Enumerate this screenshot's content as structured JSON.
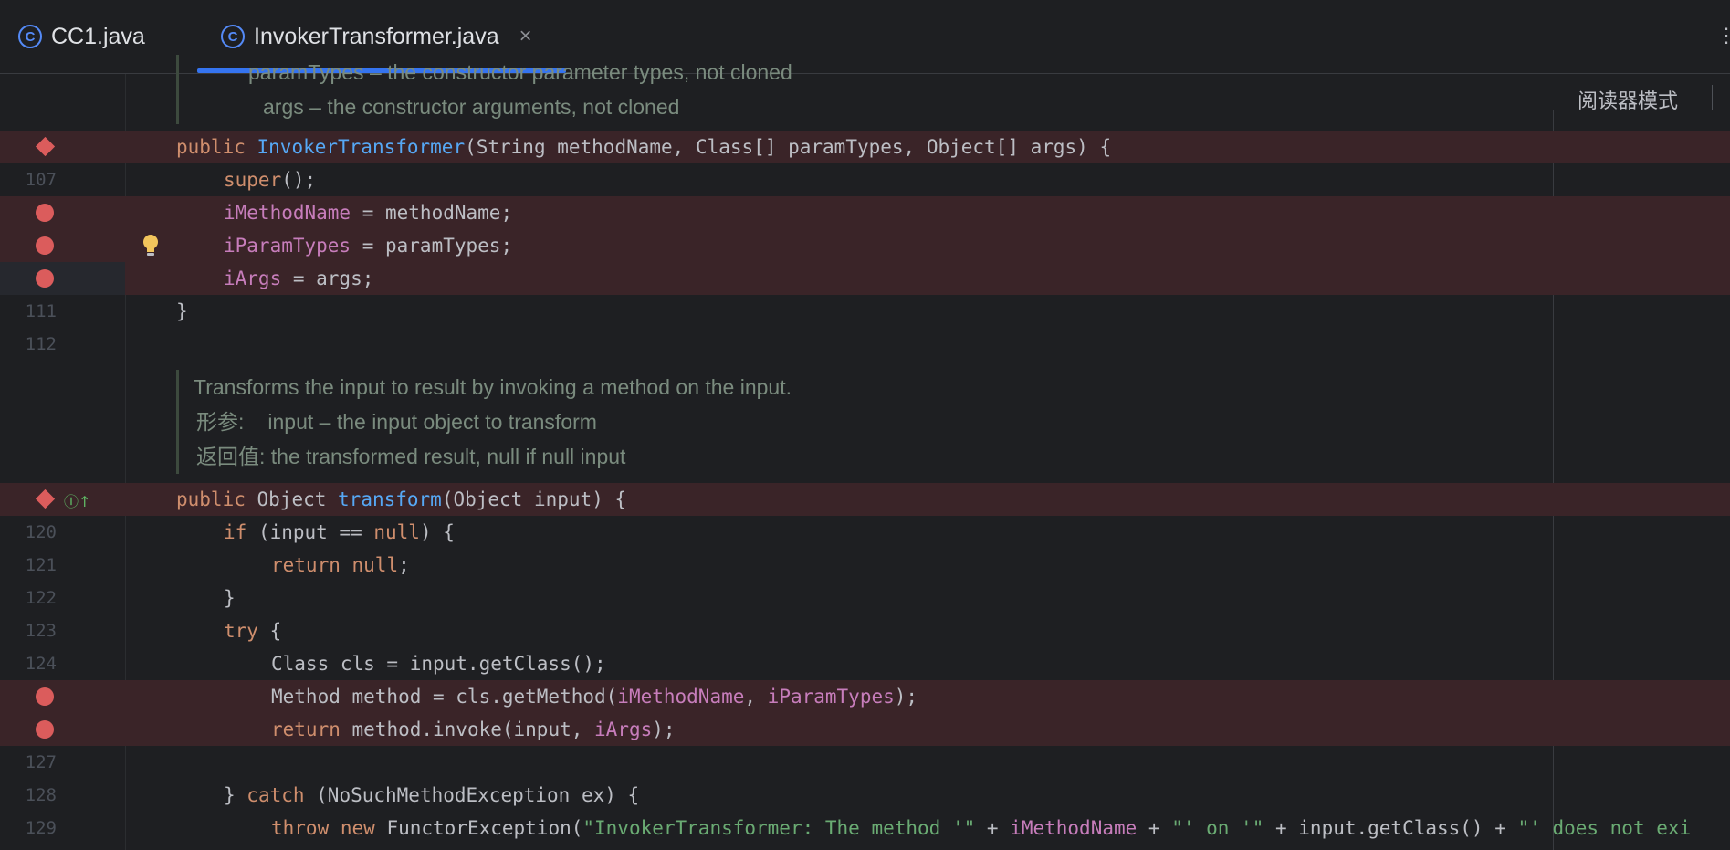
{
  "tabs": [
    {
      "icon": "class-icon",
      "icon_letter": "C",
      "label": "CC1.java",
      "active": false
    },
    {
      "icon": "class-icon",
      "icon_letter": "C",
      "label": "InvokerTransformer.java",
      "active": true,
      "close": "×"
    }
  ],
  "editor": {
    "reader_mode_label": "阅读器模式",
    "doc_top": {
      "partial_line": "paramTypes – the constructor parameter types, not cloned",
      "args_line": "args – the constructor arguments, not cloned"
    },
    "doc_transform": {
      "summary": "Transforms the input to result by invoking a method on the input.",
      "param_tag": "形参:",
      "param_text": "input – the input object to transform",
      "return_tag": "返回值:",
      "return_text": "the transformed result, null if null input"
    },
    "line_numbers": {
      "l107": "107",
      "l111": "111",
      "l112": "112",
      "l120": "120",
      "l121": "121",
      "l122": "122",
      "l123": "123",
      "l124": "124",
      "l127": "127",
      "l128": "128",
      "l129": "129"
    },
    "code": {
      "constructor_sig": {
        "kw": "public ",
        "name": "InvokerTransformer",
        "rest": "(String methodName, Class[] paramTypes, Object[] args) {"
      },
      "super_call": {
        "kw": "super",
        "rest": "();"
      },
      "assign1": {
        "field": "iMethodName",
        "rest": " = methodName;"
      },
      "assign2": {
        "field": "iParamTypes",
        "rest": " = paramTypes;"
      },
      "assign3": {
        "field": "iArgs",
        "rest": " = args;"
      },
      "close_brace": "}",
      "transform_sig": {
        "kw": "public ",
        "type": "Object ",
        "name": "transform",
        "rest": "(Object input) {"
      },
      "if_line": {
        "kw": "if ",
        "mid": "(input == ",
        "null": "null",
        "rest": ") {"
      },
      "return_null": {
        "kw": "return ",
        "null": "null",
        "rest": ";"
      },
      "if_close": "}",
      "try_line": {
        "kw": "try ",
        "rest": "{"
      },
      "class_line": "Class cls = input.getClass();",
      "method_line": {
        "pre": "Method method = cls.getMethod(",
        "f1": "iMethodName",
        "mid": ", ",
        "f2": "iParamTypes",
        "rest": ");"
      },
      "return_invoke": {
        "kw": "return ",
        "pre": "method.invoke(input, ",
        "field": "iArgs",
        "rest": ");"
      },
      "catch_line": {
        "pre": "} ",
        "kw": "catch ",
        "rest": "(NoSuchMethodException ex) {"
      },
      "throw_line": {
        "kw1": "throw ",
        "kw2": "new ",
        "pre": "FunctorException(",
        "s1": "\"InvokerTransformer: The method '\"",
        "p1": " + ",
        "field": "iMethodName",
        "p2": " + ",
        "s2": "\"' on '\"",
        "p3": " + input.getClass() + ",
        "s3": "\"' does not exi"
      }
    }
  },
  "colors": {
    "background": "#1e1f22",
    "breakpoint_line": "#3a2428",
    "breakpoint": "#db5c5c",
    "keyword": "#cf8e6d",
    "function": "#56a8f5",
    "field": "#c77dbb",
    "string": "#6aab73",
    "tab_accent": "#3574f0"
  }
}
